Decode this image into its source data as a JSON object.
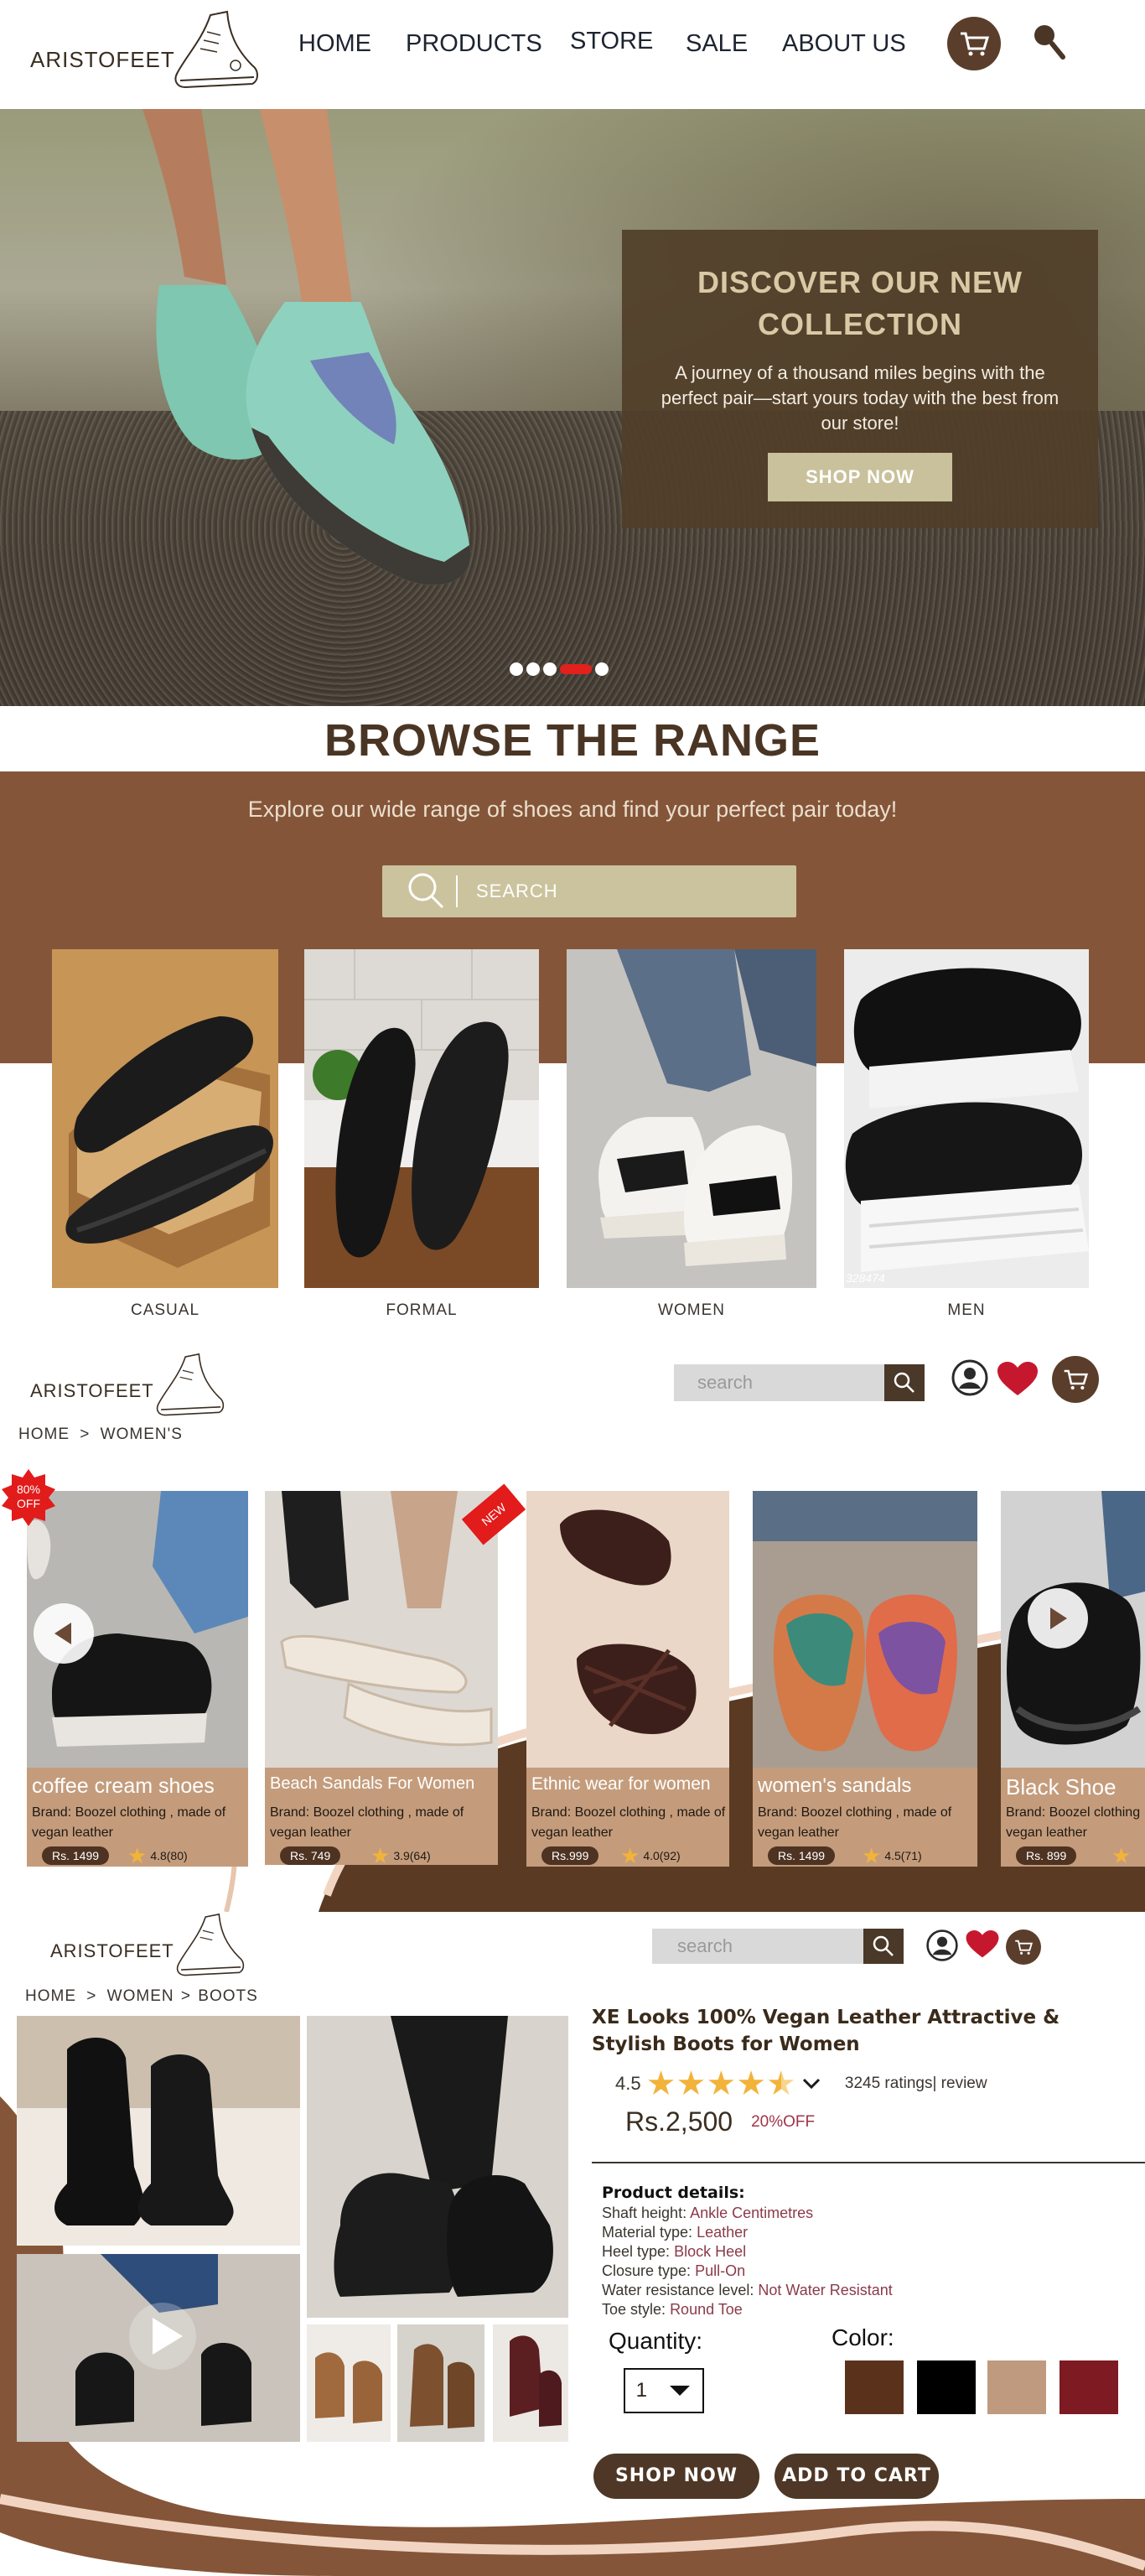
{
  "header": {
    "logo": "ARISTOFEET",
    "nav": [
      "HOME",
      "PRODUCTS",
      "STORE",
      "SALE",
      "ABOUT US"
    ]
  },
  "hero": {
    "title_line1": "DISCOVER OUR NEW",
    "title_line2": "COLLECTION",
    "text": "A journey of a thousand miles begins with the perfect pair—start yours today with the best from our store!",
    "button": "SHOP NOW",
    "slides": 5,
    "active_slide": 4
  },
  "browse": {
    "title": "BROWSE THE RANGE",
    "subtitle": "Explore our wide range of shoes and find your perfect pair today!",
    "search_placeholder": "SEARCH",
    "categories": [
      "CASUAL",
      "FORMAL",
      "WOMEN",
      "MEN"
    ],
    "watermark": "328474"
  },
  "listing": {
    "logo": "ARISTOFEET",
    "search_placeholder": "search",
    "breadcrumb": [
      "HOME",
      ">",
      "WOMEN'S"
    ],
    "badge_discount": "80%\nOFF",
    "badge_new": "NEW",
    "products": [
      {
        "name": "coffee cream shoes",
        "desc": "Brand: Boozel clothing , made of vegan leather",
        "price": "Rs. 1499",
        "rating": "4.8(80)"
      },
      {
        "name": "Beach Sandals For Women",
        "desc": "Brand: Boozel clothing , made of vegan leather",
        "price": "Rs. 749",
        "rating": "3.9(64)"
      },
      {
        "name": "Ethnic wear for women",
        "desc": "Brand: Boozel clothing , made of vegan leather",
        "price": "Rs.999",
        "rating": "4.0(92)"
      },
      {
        "name": "women's sandals",
        "desc": "Brand: Boozel clothing , made of vegan leather",
        "price": "Rs. 1499",
        "rating": "4.5(71)"
      },
      {
        "name": "Black Shoe",
        "desc": "Brand: Boozel clothing , made of vegan leather",
        "price": "Rs. 899",
        "rating": ""
      }
    ]
  },
  "detail": {
    "logo": "ARISTOFEET",
    "search_placeholder": "search",
    "breadcrumb": [
      "HOME",
      ">",
      "WOMEN",
      ">",
      "BOOTS"
    ],
    "title": "XE Looks 100% Vegan Leather Attractive & Stylish Boots for Women",
    "rating_value": "4.5",
    "rating_count": "3245 ratings| review",
    "price": "Rs.2,500",
    "discount": "20%OFF",
    "details_heading": "Product details:",
    "details": [
      {
        "label": "Shaft height:",
        "value": "Ankle Centimetres"
      },
      {
        "label": "Material type:",
        "value": "Leather"
      },
      {
        "label": "Heel type:",
        "value": "Block Heel"
      },
      {
        "label": "Closure type:",
        "value": "Pull-On"
      },
      {
        "label": "Water resistance level:",
        "value": "Not Water Resistant"
      },
      {
        "label": "Toe style:",
        "value": "Round Toe"
      }
    ],
    "quantity_label": "Quantity:",
    "quantity_value": "1",
    "color_label": "Color:",
    "colors": [
      "#5a321b",
      "#000000",
      "#bf9a7e",
      "#7d1a22"
    ],
    "shop_now": "SHOP NOW",
    "add_to_cart": "ADD TO CART"
  },
  "colors": {
    "brand_brown": "#855539",
    "dark_brown": "#4e3726",
    "sand": "#cbc39d"
  }
}
